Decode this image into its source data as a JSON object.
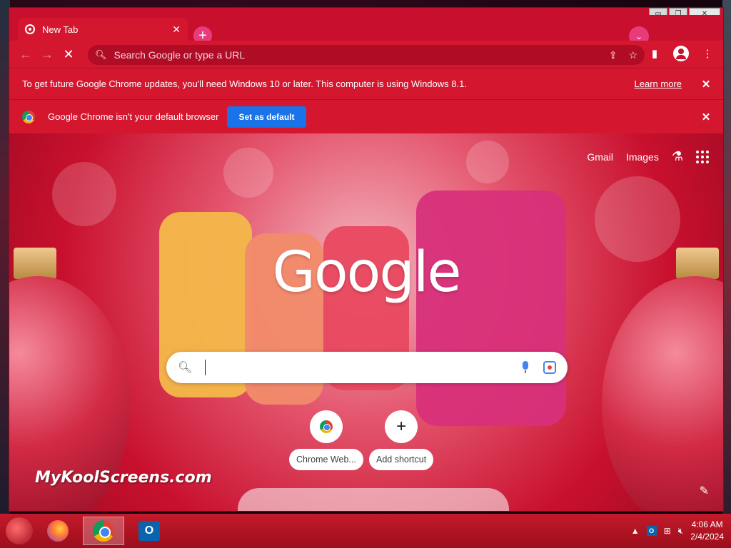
{
  "window": {
    "controls": {
      "minimize": "▭",
      "restore": "❐",
      "close": "✕"
    }
  },
  "tabs": [
    {
      "title": "New Tab",
      "close": "✕"
    }
  ],
  "toolbar": {
    "back": "←",
    "forward": "→",
    "stop": "✕",
    "omnibox_placeholder": "Search Google or type a URL",
    "search_glyph": "🔍︎",
    "share": "⇪",
    "bookmark": "☆",
    "sidepanel": "▮",
    "menu": "⋮",
    "new_tab": "+",
    "tab_search": "⌄"
  },
  "infobars": {
    "update": {
      "text": "To get future Google Chrome updates, you'll need Windows 10 or later. This computer is using Windows 8.1.",
      "link": "Learn more",
      "close": "✕"
    },
    "default_browser": {
      "text": "Google Chrome isn't your default browser",
      "button": "Set as default",
      "close": "✕"
    }
  },
  "ntp": {
    "links": {
      "gmail": "Gmail",
      "images": "Images"
    },
    "labs_icon": "⚗",
    "logo_text": "Google",
    "search": {
      "glyph": "🔍︎"
    },
    "shortcuts": [
      {
        "label": "Chrome Web...",
        "icon": "chrome-web-store-icon"
      },
      {
        "label": "Add shortcut",
        "icon": "plus-icon",
        "glyph": "+"
      }
    ],
    "watermark": "MyKoolScreens.com",
    "customize": "✎"
  },
  "taskbar": {
    "apps": [
      "firefox",
      "chrome",
      "outlook"
    ],
    "outlook_letter": "O",
    "tray": {
      "up_arrow": "▲",
      "network": "⊞",
      "volume": "🔇︎",
      "outlook_mini": "O"
    },
    "clock": {
      "time": "4:06 AM",
      "date": "2/4/2024"
    }
  },
  "colors": {
    "theme": "#c8102e",
    "toolbar": "#d4172f",
    "set_default_button": "#1a73e8"
  }
}
